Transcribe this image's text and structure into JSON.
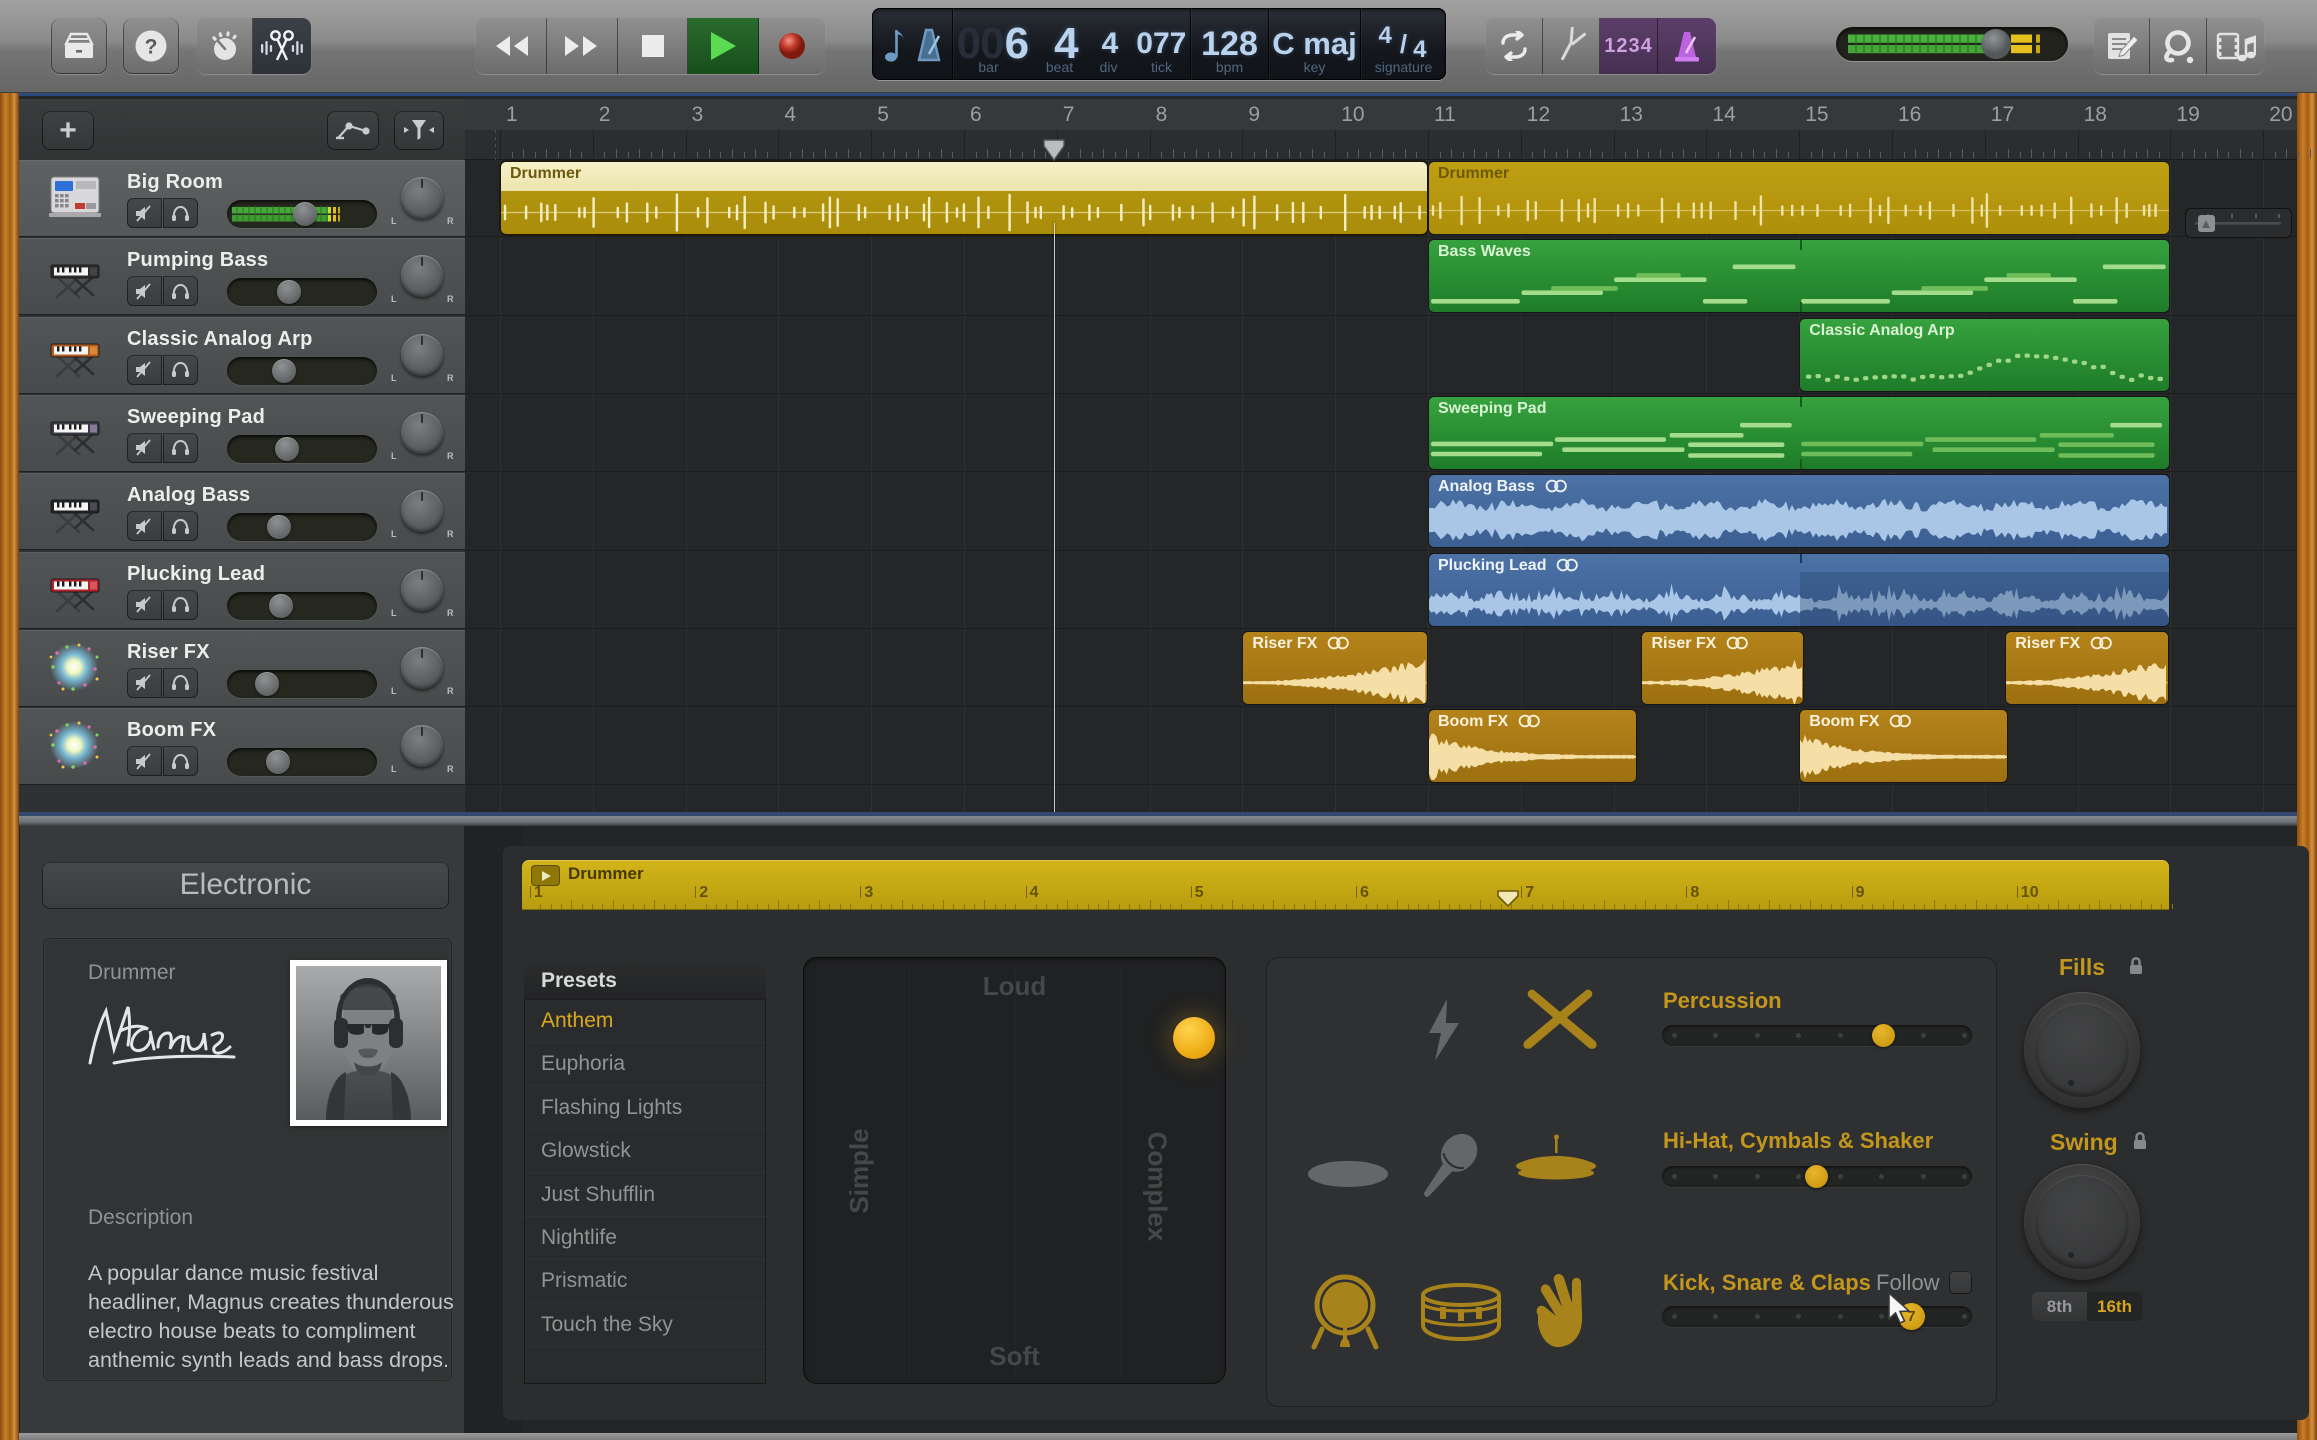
{
  "toolbar": {
    "library_button": "library",
    "help_button": "help",
    "smart_controls_button": "smart-controls",
    "editors_button": "editors",
    "transport": {
      "rewind": "rewind",
      "forward": "forward",
      "stop": "stop",
      "play": "play",
      "record": "record"
    },
    "lcd": {
      "bar_dim": "00",
      "bar_value": "6",
      "bar_label": "bar",
      "beat_value": "4",
      "beat_label": "beat",
      "div_value": "4",
      "div_label": "div",
      "tick_dim": "0",
      "tick_value": "77",
      "tick_label": "tick",
      "bpm_value": "128",
      "bpm_label": "bpm",
      "key_value": "C maj",
      "key_label": "key",
      "signature_numerator": "4",
      "signature_denominator": "4",
      "signature_label": "signature"
    },
    "cycle_button": "cycle",
    "tuner_button": "tuner",
    "count_in_label": "1234",
    "metronome_button": "metronome",
    "notepad_button": "notepad",
    "loop_browser_button": "loop-browser",
    "media_browser_button": "media-browser"
  },
  "track_header": {
    "add_track_label": "+",
    "pan_left_label": "L",
    "pan_right_label": "R",
    "tracks": [
      {
        "name": "Big Room",
        "icon": "drum-machine",
        "volume": 0.52,
        "selected": true,
        "meter": true
      },
      {
        "name": "Pumping Bass",
        "icon": "keyboard-dark",
        "volume": 0.4,
        "selected": false,
        "meter": false
      },
      {
        "name": "Classic Analog Arp",
        "icon": "keyboard-orange",
        "volume": 0.36,
        "selected": false,
        "meter": false
      },
      {
        "name": "Sweeping Pad",
        "icon": "keyboard-gray",
        "volume": 0.38,
        "selected": false,
        "meter": false
      },
      {
        "name": "Analog Bass",
        "icon": "keyboard-black",
        "volume": 0.32,
        "selected": false,
        "meter": false
      },
      {
        "name": "Plucking Lead",
        "icon": "keyboard-red",
        "volume": 0.33,
        "selected": false,
        "meter": false
      },
      {
        "name": "Riser FX",
        "icon": "starburst",
        "volume": 0.22,
        "selected": false,
        "meter": false
      },
      {
        "name": "Boom FX",
        "icon": "starburst",
        "volume": 0.31,
        "selected": false,
        "meter": false
      }
    ]
  },
  "ruler": {
    "bars": [
      1,
      2,
      3,
      4,
      5,
      6,
      7,
      8,
      9,
      10,
      11,
      12,
      13,
      14,
      15,
      16,
      17,
      18,
      19,
      20
    ],
    "playhead_bar": 6.97
  },
  "regions": [
    {
      "label": "Drummer",
      "track": 0,
      "start": 1,
      "end": 11,
      "kind": "drummer",
      "selected": true,
      "loop": false
    },
    {
      "label": "Drummer",
      "track": 0,
      "start": 11,
      "end": 19,
      "kind": "drummer",
      "selected": false,
      "loop": false
    },
    {
      "label": "Bass Waves",
      "track": 1,
      "start": 11,
      "end": 19,
      "kind": "midi",
      "selected": false,
      "loop": false,
      "split": 15,
      "pattern": "bass-waves"
    },
    {
      "label": "Classic Analog Arp",
      "track": 2,
      "start": 15,
      "end": 19,
      "kind": "midi",
      "selected": false,
      "loop": false,
      "pattern": "arp-dots"
    },
    {
      "label": "Sweeping Pad",
      "track": 3,
      "start": 11,
      "end": 19,
      "kind": "midi",
      "selected": false,
      "loop": false,
      "split": 15,
      "pattern": "pad-lines"
    },
    {
      "label": "Analog Bass",
      "track": 4,
      "start": 11,
      "end": 19,
      "kind": "audio",
      "selected": false,
      "loop": true,
      "wave": "dense"
    },
    {
      "label": "Plucking Lead",
      "track": 5,
      "start": 11,
      "end": 19,
      "kind": "audio",
      "selected": false,
      "loop": true,
      "split": 15,
      "wave": "plucky"
    },
    {
      "label": "Riser FX",
      "track": 6,
      "start": 9,
      "end": 11,
      "kind": "fx",
      "selected": false,
      "loop": true,
      "wave": "riser"
    },
    {
      "label": "Riser FX",
      "track": 6,
      "start": 13.3,
      "end": 15.05,
      "kind": "fx",
      "selected": false,
      "loop": true,
      "wave": "riser"
    },
    {
      "label": "Riser FX",
      "track": 6,
      "start": 17.22,
      "end": 18.98,
      "kind": "fx",
      "selected": false,
      "loop": true,
      "wave": "riser"
    },
    {
      "label": "Boom FX",
      "track": 7,
      "start": 11,
      "end": 13.25,
      "kind": "fx",
      "selected": false,
      "loop": true,
      "wave": "boom"
    },
    {
      "label": "Boom FX",
      "track": 7,
      "start": 15,
      "end": 17.25,
      "kind": "fx",
      "selected": false,
      "loop": true,
      "wave": "boom"
    }
  ],
  "editor": {
    "library": {
      "category": "Electronic",
      "drummer_label": "Drummer",
      "signature": "Magnus",
      "description_label": "Description",
      "description": "A popular dance music festival headliner, Magnus creates thunderous electro house beats to compliment anthemic synth leads and bass drops."
    },
    "mini_ruler": {
      "title": "Drummer",
      "bars": [
        1,
        2,
        3,
        4,
        5,
        6,
        7,
        8,
        9,
        10
      ],
      "playhead_bar": 6.92
    },
    "presets": {
      "header": "Presets",
      "items": [
        "Anthem",
        "Euphoria",
        "Flashing Lights",
        "Glowstick",
        "Just Shufflin",
        "Nightlife",
        "Prismatic",
        "Touch the Sky"
      ],
      "selected": "Anthem"
    },
    "xy_pad": {
      "top": "Loud",
      "bottom": "Soft",
      "left": "Simple",
      "right": "Complex",
      "puck_x": 0.925,
      "puck_y": 0.19
    },
    "controls": {
      "rows": [
        {
          "label": "Percussion",
          "value": 0.735,
          "icons": [
            "lightning",
            "drumsticks"
          ],
          "active_icons": [
            false,
            true
          ]
        },
        {
          "label": "Hi-Hat, Cymbals & Shaker",
          "value": 0.5,
          "icons": [
            "tambourine",
            "shaker",
            "hihat"
          ],
          "active_icons": [
            false,
            false,
            true
          ]
        },
        {
          "label": "Kick, Snare & Claps",
          "value": 0.825,
          "icons": [
            "kick",
            "snare",
            "claps"
          ],
          "active_icons": [
            true,
            true,
            true
          ],
          "follow_label": "Follow",
          "badge": "7"
        }
      ],
      "fills_label": "Fills",
      "swing_label": "Swing",
      "eighth_label": "8th",
      "sixteenth_label": "16th"
    }
  }
}
